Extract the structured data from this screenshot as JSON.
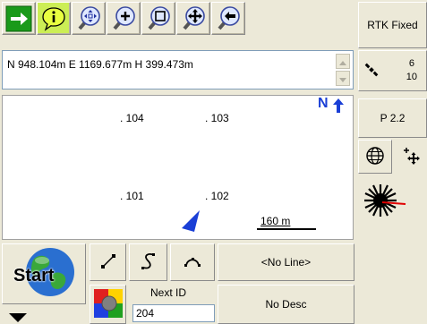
{
  "toolbar": {
    "buttons": [
      {
        "name": "go-arrow-icon"
      },
      {
        "name": "info-icon"
      },
      {
        "name": "zoom-extents-icon"
      },
      {
        "name": "zoom-in-icon"
      },
      {
        "name": "zoom-window-icon"
      },
      {
        "name": "pan-icon"
      },
      {
        "name": "back-icon"
      }
    ]
  },
  "status": {
    "rtk_label": "RTK Fixed",
    "satellites_top": "6",
    "satellites_bottom": "10",
    "pdop": "P 2.2"
  },
  "position": {
    "text": "N 948.104m  E 1169.677m  H 399.473m"
  },
  "map": {
    "north_label": "N",
    "points": [
      {
        "label": ". 104"
      },
      {
        "label": ". 103"
      },
      {
        "label": ". 101"
      },
      {
        "label": ". 102"
      }
    ],
    "scale_label": "160 m"
  },
  "controls": {
    "start_label": "Start",
    "line_label": "<No Line>",
    "next_id_label": "Next ID",
    "next_id_value": "204",
    "desc_label": "No Desc"
  },
  "colors": {
    "go_green": "#1a9a1a",
    "info_active": "#ccee55",
    "north_blue": "#1a3fd6",
    "laser_red": "#e00000"
  }
}
